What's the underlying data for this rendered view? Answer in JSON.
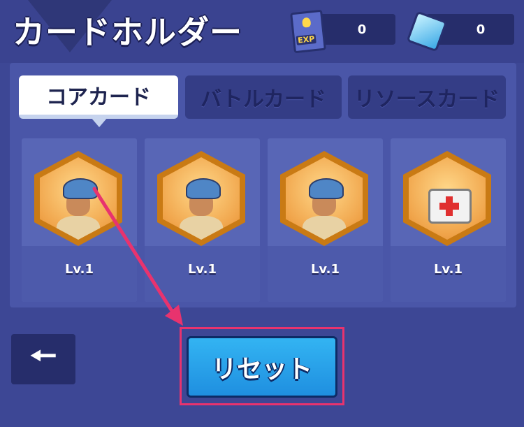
{
  "header": {
    "title": "カードホルダー",
    "exp_count": "0",
    "gem_count": "0",
    "exp_icon_label": "EXP"
  },
  "tabs": [
    {
      "label": "コアカード",
      "selected": true
    },
    {
      "label": "バトルカード",
      "selected": false
    },
    {
      "label": "リソースカード",
      "selected": false
    }
  ],
  "cards": [
    {
      "level": "Lv.1",
      "icon": "soldier-portrait-icon"
    },
    {
      "level": "Lv.1",
      "icon": "soldier-portrait-icon"
    },
    {
      "level": "Lv.1",
      "icon": "soldier-portrait-icon"
    },
    {
      "level": "Lv.1",
      "icon": "medkit-icon"
    }
  ],
  "footer": {
    "back_icon": "back-arrow-icon",
    "reset_label": "リセット"
  },
  "colors": {
    "background": "#3d4795",
    "highlight": "#e8336e",
    "reset_button": "#1f8fe0"
  }
}
